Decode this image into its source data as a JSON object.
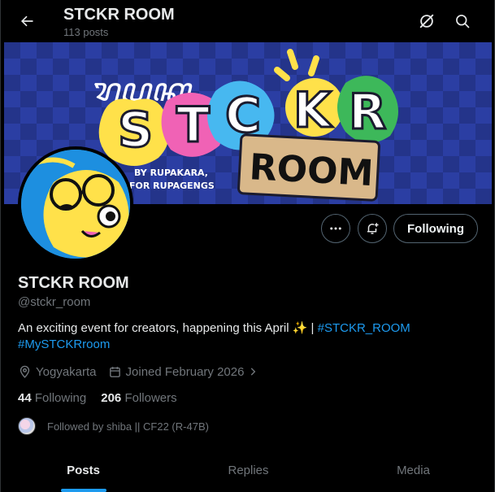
{
  "header": {
    "title": "STCKR ROOM",
    "post_count": "113 posts"
  },
  "banner": {
    "script_text": "ꦫꦸꦥꦏ",
    "word1": "STCKR",
    "word2": "ROOM",
    "tagline1": "BY RUPAKARA,",
    "tagline2": "FOR RUPAGENGS"
  },
  "actions": {
    "following_label": "Following"
  },
  "profile": {
    "name": "STCKR ROOM",
    "handle": "@stckr_room",
    "bio_text": "An exciting event for creators, happening this April ✨ | ",
    "hashtag1": "#STCKR_ROOM",
    "hashtag2": "#MySTCKRroom",
    "location": "Yogyakarta",
    "joined": "Joined February 2026"
  },
  "stats": {
    "following_count": "44",
    "following_label": "Following",
    "followers_count": "206",
    "followers_label": "Followers"
  },
  "followed_by": "Followed by shiba || CF22 (R-47B)",
  "tabs": [
    {
      "label": "Posts"
    },
    {
      "label": "Replies"
    },
    {
      "label": "Media"
    }
  ],
  "colors": {
    "accent": "#1d9bf0",
    "background": "#000000",
    "muted": "#71767b"
  }
}
